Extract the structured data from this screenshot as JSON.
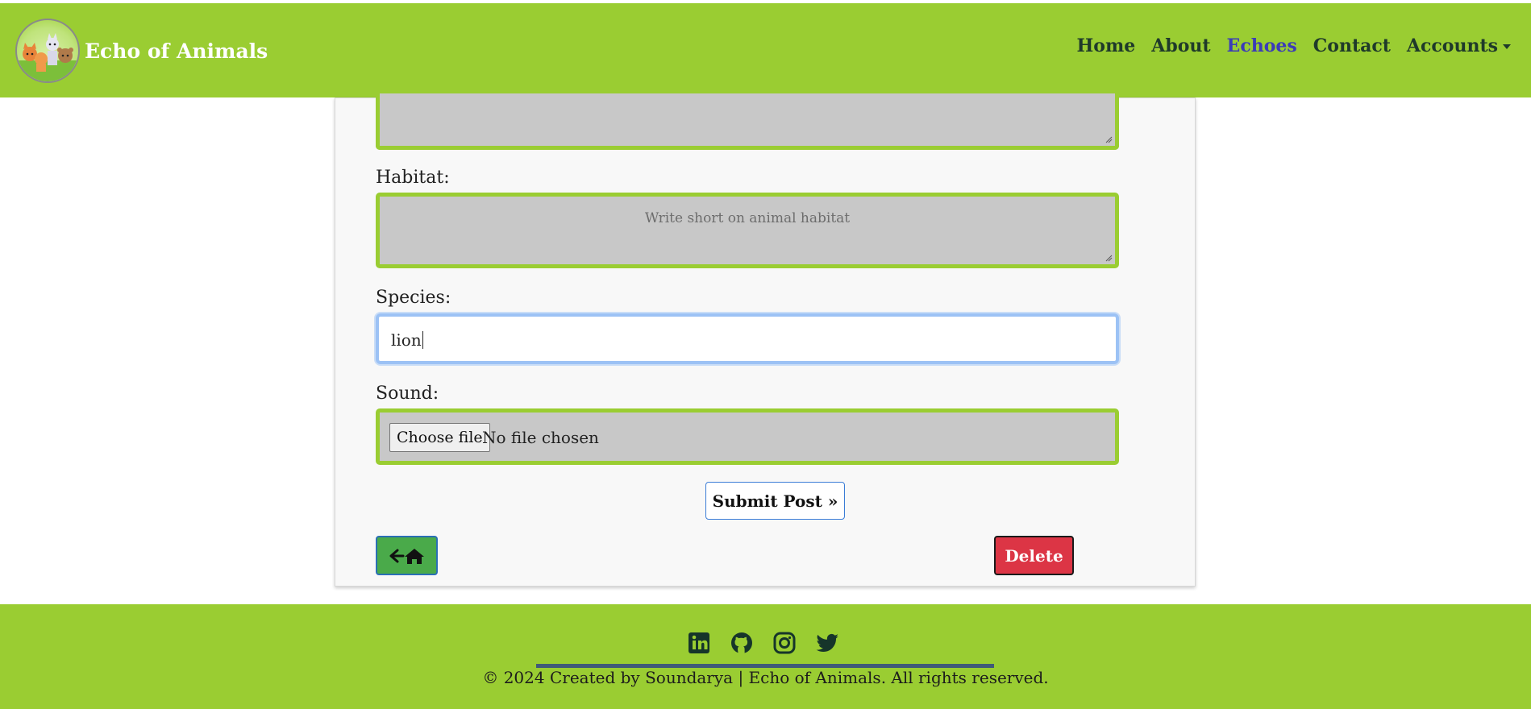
{
  "header": {
    "brand": "Echo of Animals",
    "nav": [
      {
        "label": "Home"
      },
      {
        "label": "About"
      },
      {
        "label": "Echoes"
      },
      {
        "label": "Contact"
      },
      {
        "label": "Accounts"
      }
    ],
    "active_nav": "Echoes"
  },
  "form": {
    "habitat_label": "Habitat:",
    "habitat_placeholder": "Write short on animal habitat",
    "species_label": "Species:",
    "species_value": "lion",
    "sound_label": "Sound:",
    "choose_file_label": "Choose file",
    "no_file_text": "No file chosen",
    "submit_label": "Submit Post »",
    "delete_label": "Delete"
  },
  "footer": {
    "social_icons": [
      "linkedin-icon",
      "github-icon",
      "instagram-icon",
      "twitter-icon"
    ],
    "copyright": "© 2024 Created by Soundarya | Echo of Animals. All rights reserved."
  },
  "colors": {
    "brand_green": "#9acd32",
    "input_bg": "#c8c8c8",
    "focus_blue": "#9cc2f5",
    "delete_red": "#dc3545",
    "back_green": "#4aaa4a",
    "active_link": "#3b3bb8"
  }
}
